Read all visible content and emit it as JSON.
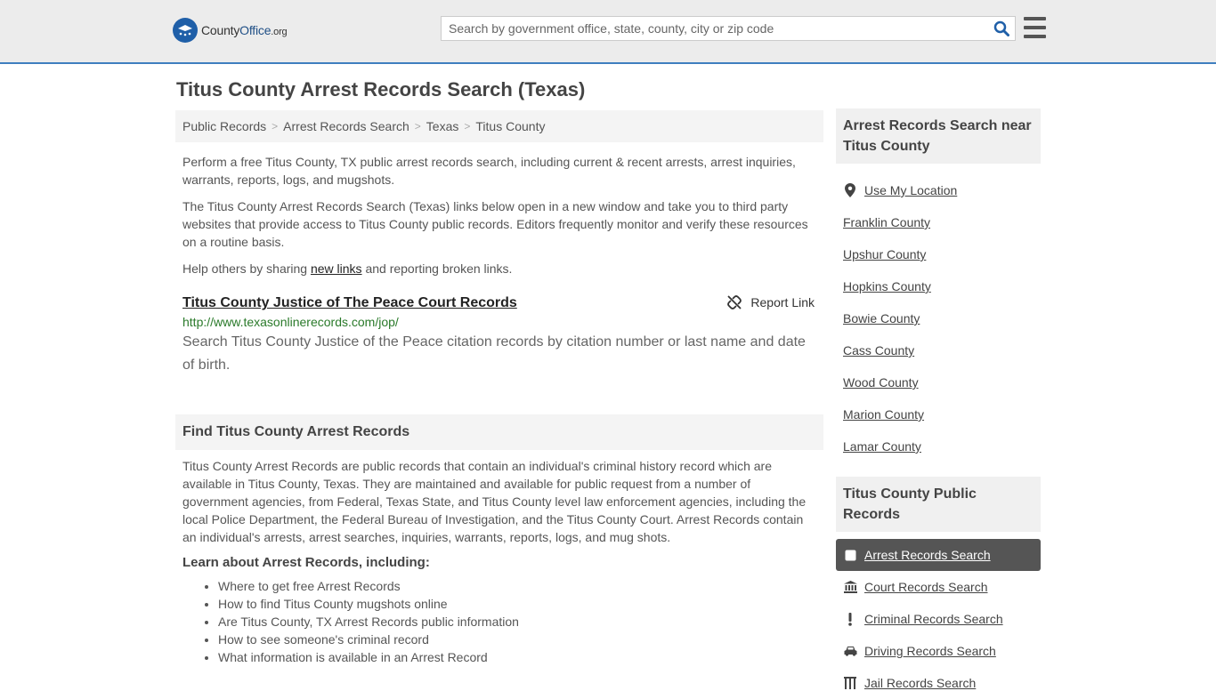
{
  "header": {
    "logo_text_a": "County",
    "logo_text_b": "Office",
    "logo_text_c": ".org",
    "search_placeholder": "Search by government office, state, county, city or zip code"
  },
  "page": {
    "title": "Titus County Arrest Records Search (Texas)"
  },
  "breadcrumb": [
    "Public Records",
    "Arrest Records Search",
    "Texas",
    "Titus County"
  ],
  "intro": {
    "p1": "Perform a free Titus County, TX public arrest records search, including current & recent arrests, arrest inquiries, warrants, reports, logs, and mugshots.",
    "p2": "The Titus County Arrest Records Search (Texas) links below open in a new window and take you to third party websites that provide access to Titus County public records. Editors frequently monitor and verify these resources on a routine basis.",
    "p3_before": "Help others by sharing ",
    "p3_link": "new links",
    "p3_after": " and reporting broken links."
  },
  "record": {
    "title": "Titus County Justice of The Peace Court Records",
    "report_label": "Report Link",
    "url": "http://www.texasonlinerecords.com/jop/",
    "description": "Search Titus County Justice of the Peace citation records by citation number or last name and date of birth."
  },
  "find": {
    "heading": "Find Titus County Arrest Records",
    "body": "Titus County Arrest Records are public records that contain an individual's criminal history record which are available in Titus County, Texas. They are maintained and available for public request from a number of government agencies, from Federal, Texas State, and Titus County level law enforcement agencies, including the local Police Department, the Federal Bureau of Investigation, and the Titus County Court. Arrest Records contain an individual's arrests, arrest searches, inquiries, warrants, reports, logs, and mug shots.",
    "learn_heading": "Learn about Arrest Records, including:",
    "learn_items": [
      "Where to get free Arrest Records",
      "How to find Titus County mugshots online",
      "Are Titus County, TX Arrest Records public information",
      "How to see someone's criminal record",
      "What information is available in an Arrest Record"
    ]
  },
  "sidebar": {
    "near_heading": "Arrest Records Search near Titus County",
    "use_location": "Use My Location",
    "counties": [
      "Franklin County",
      "Upshur County",
      "Hopkins County",
      "Bowie County",
      "Cass County",
      "Wood County",
      "Marion County",
      "Lamar County"
    ],
    "public_heading": "Titus County Public Records",
    "public_items": [
      {
        "label": "Arrest Records Search",
        "icon": "checkbox-icon",
        "active": true
      },
      {
        "label": "Court Records Search",
        "icon": "courthouse-icon",
        "active": false
      },
      {
        "label": "Criminal Records Search",
        "icon": "exclamation-icon",
        "active": false
      },
      {
        "label": "Driving Records Search",
        "icon": "car-icon",
        "active": false
      },
      {
        "label": "Jail Records Search",
        "icon": "jail-icon",
        "active": false
      }
    ]
  },
  "colors": {
    "accent": "#3f7fbf",
    "link_green": "#2a7a2a",
    "active_bg": "#555555"
  }
}
